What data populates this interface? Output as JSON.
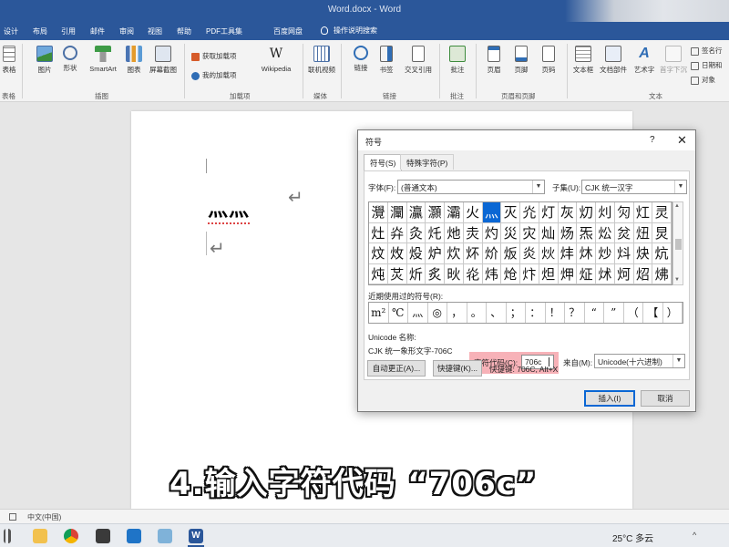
{
  "window": {
    "title": "Word.docx - Word"
  },
  "ribbon_tabs": [
    "设计",
    "布局",
    "引用",
    "邮件",
    "审阅",
    "视图",
    "帮助",
    "PDF工具集",
    "百度网盘"
  ],
  "tell_me": "操作说明搜索",
  "ribbon": {
    "buttons": {
      "table": "表格",
      "pictures": "图片",
      "shapes": "形状",
      "smartart": "SmartArt",
      "chart": "图表",
      "screenshot": "屏幕截图",
      "get_addins": "获取加载项",
      "my_addins": "我的加载项",
      "wikipedia": "Wikipedia",
      "online_video": "联机视频",
      "link": "链接",
      "bookmark": "书签",
      "crossref": "交叉引用",
      "comment": "批注",
      "header": "页眉",
      "footer": "页脚",
      "page_number": "页码",
      "textbox": "文本框",
      "quickparts": "文档部件",
      "wordart": "艺术字",
      "dropcap": "首字下沉",
      "signature": "签名行",
      "datetime": "日期和",
      "object": "对象"
    },
    "groups": {
      "tables": "表格",
      "illustrations": "插图",
      "addins": "加载项",
      "media": "媒体",
      "links": "链接",
      "comments": "批注",
      "header_footer": "页眉和页脚",
      "text": "文本"
    }
  },
  "document": {
    "text": "灬灬",
    "return_mark": "↵"
  },
  "caption": "4.输入字符代码 “706c”",
  "statusbar": {
    "language": "中文(中国)"
  },
  "taskbar": {
    "weather": "25°C 多云",
    "chevron": "^"
  },
  "dialog": {
    "title": "符号",
    "help": "?",
    "close": "✕",
    "tabs": [
      "符号(S)",
      "特殊字符(P)"
    ],
    "font_label": "字体(F):",
    "font_value": "(普通文本)",
    "subset_label": "子集(U):",
    "subset_value": "CJK 统一汉字",
    "grid": [
      "灚",
      "灛",
      "灜",
      "灝",
      "灞",
      "火",
      "灬",
      "灭",
      "灮",
      "灯",
      "灰",
      "灱",
      "灲",
      "灳",
      "灴",
      "灵",
      "灶",
      "灷",
      "灸",
      "灹",
      "灺",
      "灻",
      "灼",
      "災",
      "灾",
      "灿",
      "炀",
      "炁",
      "炂",
      "炃",
      "炄",
      "炅",
      "炆",
      "炇",
      "炈",
      "炉",
      "炊",
      "炋",
      "炌",
      "炍",
      "炎",
      "炏",
      "炐",
      "炑",
      "炒",
      "炓",
      "炔",
      "炕",
      "炖",
      "炗",
      "炘",
      "炙",
      "炚",
      "炛",
      "炜",
      "炝",
      "炞",
      "炟",
      "炠",
      "炡",
      "炢",
      "炣",
      "炤",
      "炥"
    ],
    "selected_index": 6,
    "recent_label": "近期使用过的符号(R):",
    "recent": [
      "m²",
      "℃",
      "灬",
      "◎",
      "，",
      "。",
      "、",
      "；",
      "：",
      "！",
      "？",
      "“",
      "”",
      "（",
      "【",
      "）"
    ],
    "unicode_name_label": "Unicode 名称:",
    "unicode_name_value": "CJK 统一象形文字-706C",
    "char_code_label": "字符代码(C):",
    "char_code_value": "706c",
    "from_label": "来自(M):",
    "from_value": "Unicode(十六进制)",
    "autocorrect_button": "自动更正(A)...",
    "shortcut_key_button": "快捷键(K)...",
    "shortcut_text": "快捷键: 706C, Alt+X",
    "insert_button": "插入(I)",
    "cancel_button": "取消"
  }
}
